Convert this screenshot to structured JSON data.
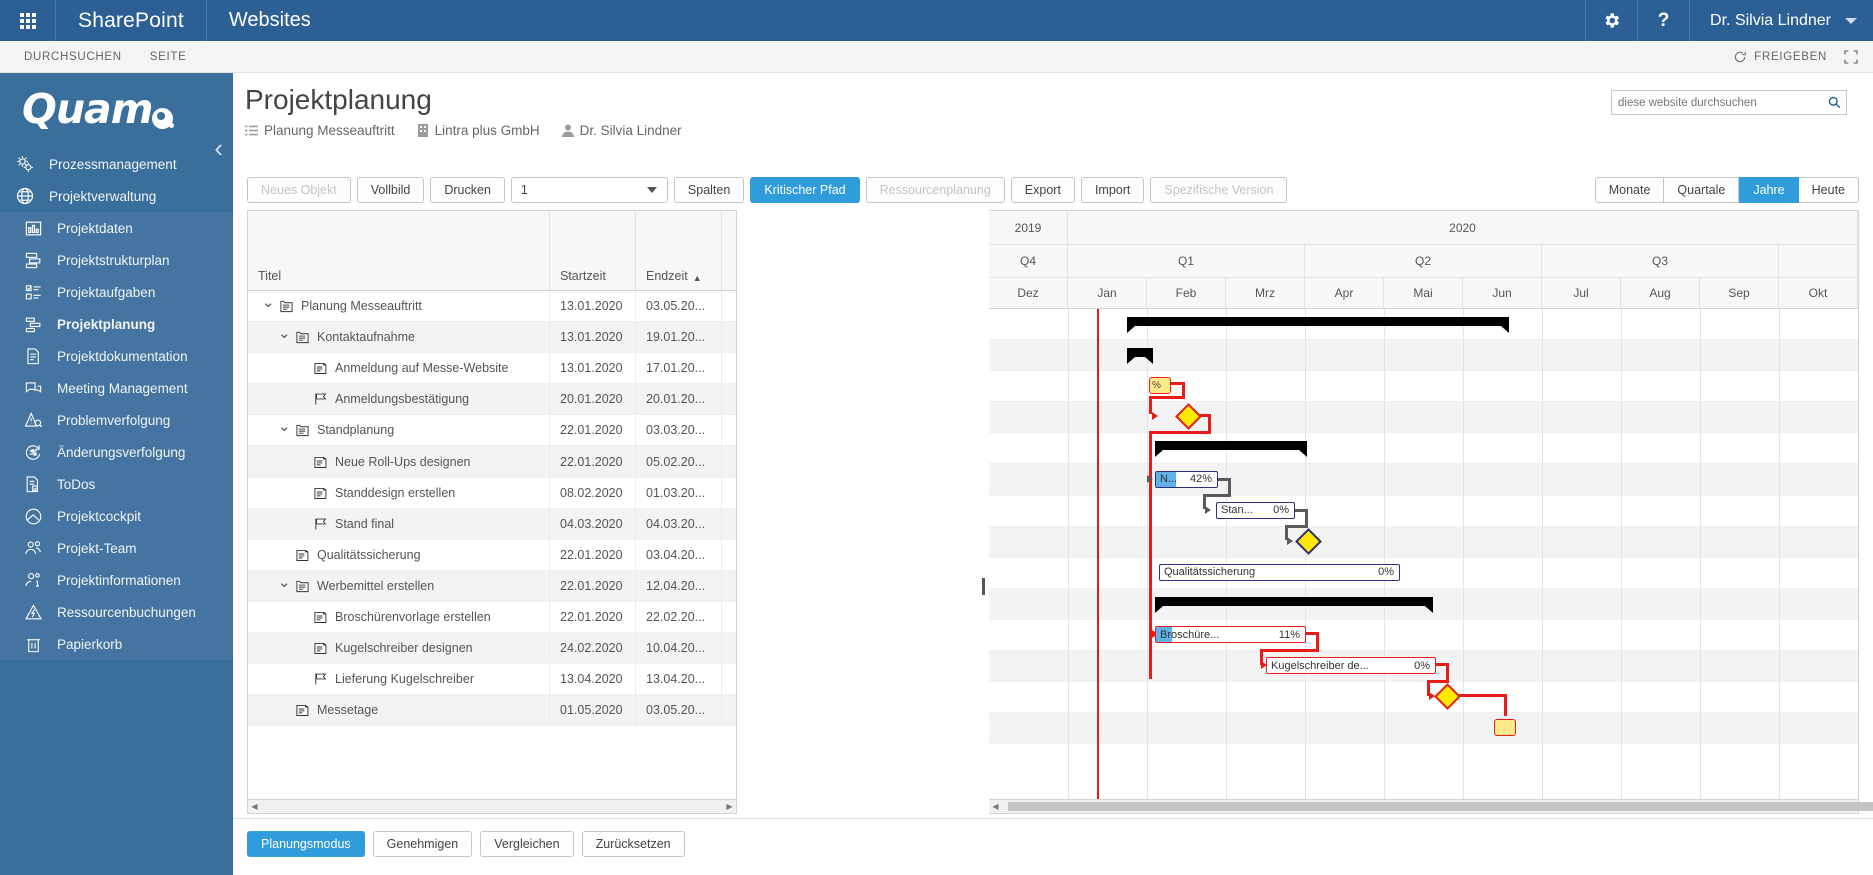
{
  "suitebar": {
    "waffle_icon": "app-launcher-icon",
    "brand": "SharePoint",
    "site": "Websites",
    "settings_icon": "gear-icon",
    "help_icon": "help-icon",
    "user": "Dr. Silvia Lindner"
  },
  "ribbon": {
    "tabs": [
      "DURCHSUCHEN",
      "SEITE"
    ],
    "share_label": "FREIGEBEN",
    "focus_icon": "focus-on-content-icon"
  },
  "leftnav": {
    "logo": "Quam",
    "collapse_icon": "chevron-left-icon",
    "items": [
      {
        "label": "Prozessmanagement",
        "icon": "gears-icon",
        "level": 0,
        "active": false
      },
      {
        "label": "Projektverwaltung",
        "icon": "globe-icon",
        "level": 0,
        "active": false
      },
      {
        "label": "Projektdaten",
        "icon": "bar-chart-icon",
        "level": 1,
        "active": false
      },
      {
        "label": "Projektstrukturplan",
        "icon": "structure-icon",
        "level": 1,
        "active": false
      },
      {
        "label": "Projektaufgaben",
        "icon": "tasklist-icon",
        "level": 1,
        "active": false
      },
      {
        "label": "Projektplanung",
        "icon": "gantt-icon",
        "level": 1,
        "active": true
      },
      {
        "label": "Projektdokumentation",
        "icon": "document-icon",
        "level": 1,
        "active": false
      },
      {
        "label": "Meeting Management",
        "icon": "chat-icon",
        "level": 1,
        "active": false
      },
      {
        "label": "Problemverfolgung",
        "icon": "warning-search-icon",
        "level": 1,
        "active": false
      },
      {
        "label": "Änderungsverfolgung",
        "icon": "change-icon",
        "level": 1,
        "active": false
      },
      {
        "label": "ToDos",
        "icon": "checklist-icon",
        "level": 1,
        "active": false
      },
      {
        "label": "Projektcockpit",
        "icon": "gauge-icon",
        "level": 1,
        "active": false
      },
      {
        "label": "Projekt-Team",
        "icon": "people-icon",
        "level": 1,
        "active": false
      },
      {
        "label": "Projektinformationen",
        "icon": "person-info-icon",
        "level": 1,
        "active": false
      },
      {
        "label": "Ressourcenbuchungen",
        "icon": "resource-icon",
        "level": 1,
        "active": false
      },
      {
        "label": "Papierkorb",
        "icon": "trash-icon",
        "level": 1,
        "active": false
      }
    ]
  },
  "page": {
    "title": "Projektplanung",
    "breadcrumb": [
      {
        "label": "Planung Messeauftritt",
        "icon": "list-icon"
      },
      {
        "label": "Lintra plus GmbH",
        "icon": "building-icon"
      },
      {
        "label": "Dr. Silvia Lindner",
        "icon": "person-icon"
      }
    ]
  },
  "search": {
    "placeholder": "diese website durchsuchen",
    "value": "",
    "icon": "search-icon"
  },
  "toolbar": {
    "buttons": [
      {
        "label": "Neues Objekt",
        "state": "disabled"
      },
      {
        "label": "Vollbild",
        "state": "normal"
      },
      {
        "label": "Drucken",
        "state": "normal"
      }
    ],
    "version_select": {
      "value": "1",
      "icon": "chevron-down-icon"
    },
    "buttons2": [
      {
        "label": "Spalten",
        "state": "normal"
      },
      {
        "label": "Kritischer Pfad",
        "state": "primary"
      },
      {
        "label": "Ressourcenplanung",
        "state": "disabled"
      },
      {
        "label": "Export",
        "state": "normal"
      },
      {
        "label": "Import",
        "state": "normal"
      },
      {
        "label": "Spezifische Version",
        "state": "disabled"
      }
    ],
    "zoom_buttons": [
      {
        "label": "Monate",
        "state": "normal"
      },
      {
        "label": "Quartale",
        "state": "normal"
      },
      {
        "label": "Jahre",
        "state": "primary"
      },
      {
        "label": "Heute",
        "state": "normal"
      }
    ],
    "accent_color": "#2f9ddb"
  },
  "grid": {
    "columns": [
      "Titel",
      "Startzeit",
      "Endzeit"
    ],
    "sort_column": "Endzeit",
    "sort_dir": "asc",
    "sort_icon": "caret-up-icon",
    "rows": [
      {
        "title": "Planung Messeauftritt",
        "start": "13.01.2020",
        "end": "03.05.20...",
        "level": 0,
        "expanded": true,
        "icon": "summary-icon"
      },
      {
        "title": "Kontaktaufnahme",
        "start": "13.01.2020",
        "end": "19.01.20...",
        "level": 1,
        "expanded": true,
        "icon": "summary-icon"
      },
      {
        "title": "Anmeldung auf Messe-Website",
        "start": "13.01.2020",
        "end": "17.01.20...",
        "level": 2,
        "expanded": null,
        "icon": "task-icon"
      },
      {
        "title": "Anmeldungsbestätigung",
        "start": "20.01.2020",
        "end": "20.01.20...",
        "level": 2,
        "expanded": null,
        "icon": "milestone-icon"
      },
      {
        "title": "Standplanung",
        "start": "22.01.2020",
        "end": "03.03.20...",
        "level": 1,
        "expanded": true,
        "icon": "summary-icon"
      },
      {
        "title": "Neue Roll-Ups designen",
        "start": "22.01.2020",
        "end": "05.02.20...",
        "level": 2,
        "expanded": null,
        "icon": "task-icon"
      },
      {
        "title": "Standdesign erstellen",
        "start": "08.02.2020",
        "end": "01.03.20...",
        "level": 2,
        "expanded": null,
        "icon": "task-icon"
      },
      {
        "title": "Stand final",
        "start": "04.03.2020",
        "end": "04.03.20...",
        "level": 2,
        "expanded": null,
        "icon": "milestone-icon"
      },
      {
        "title": "Qualitätssicherung",
        "start": "22.01.2020",
        "end": "03.04.20...",
        "level": 1,
        "expanded": null,
        "icon": "task-icon"
      },
      {
        "title": "Werbemittel erstellen",
        "start": "22.01.2020",
        "end": "12.04.20...",
        "level": 1,
        "expanded": true,
        "icon": "summary-icon"
      },
      {
        "title": "Broschürenvorlage erstellen",
        "start": "22.01.2020",
        "end": "22.02.20...",
        "level": 2,
        "expanded": null,
        "icon": "task-icon"
      },
      {
        "title": "Kugelschreiber designen",
        "start": "24.02.2020",
        "end": "10.04.20...",
        "level": 2,
        "expanded": null,
        "icon": "task-icon"
      },
      {
        "title": "Lieferung Kugelschreiber",
        "start": "13.04.2020",
        "end": "13.04.20...",
        "level": 2,
        "expanded": null,
        "icon": "milestone-icon"
      },
      {
        "title": "Messetage",
        "start": "01.05.2020",
        "end": "03.05.20...",
        "level": 1,
        "expanded": null,
        "icon": "task-icon"
      }
    ]
  },
  "timeline": {
    "years": [
      {
        "label": "2019",
        "months": 1
      },
      {
        "label": "2020",
        "months": 10
      }
    ],
    "quarters": [
      {
        "label": "Q4",
        "months": 1
      },
      {
        "label": "Q1",
        "months": 3
      },
      {
        "label": "Q2",
        "months": 3
      },
      {
        "label": "Q3",
        "months": 3
      },
      {
        "label": "",
        "months": 1
      }
    ],
    "months": [
      "Dez",
      "Jan",
      "Feb",
      "Mrz",
      "Apr",
      "Mai",
      "Jun",
      "Jul",
      "Aug",
      "Sep",
      "Okt"
    ],
    "today_marker": true
  },
  "gantt": {
    "bars": [
      {
        "row": 0,
        "type": "summary",
        "label": "",
        "pct": ""
      },
      {
        "row": 1,
        "type": "summary",
        "label": "",
        "pct": ""
      },
      {
        "row": 2,
        "type": "flag",
        "label": "%",
        "pct": ""
      },
      {
        "row": 3,
        "type": "milestone",
        "label": "",
        "pct": "",
        "critical": true
      },
      {
        "row": 4,
        "type": "summary",
        "label": "",
        "pct": ""
      },
      {
        "row": 5,
        "type": "task",
        "label": "N...",
        "pct": "42%",
        "progress": 42,
        "critical": false
      },
      {
        "row": 6,
        "type": "task",
        "label": "Stan...",
        "pct": "0%",
        "progress": 0,
        "critical": false
      },
      {
        "row": 7,
        "type": "milestone",
        "label": "",
        "pct": "",
        "critical": false
      },
      {
        "row": 8,
        "type": "task",
        "label": "Qualitätssicherung",
        "pct": "0%",
        "progress": 0,
        "critical": false
      },
      {
        "row": 9,
        "type": "summary",
        "label": "",
        "pct": ""
      },
      {
        "row": 10,
        "type": "task",
        "label": "Broschüre...",
        "pct": "11%",
        "progress": 11,
        "critical": true
      },
      {
        "row": 11,
        "type": "task",
        "label": "Kugelschreiber de...",
        "pct": "0%",
        "progress": 0,
        "critical": true
      },
      {
        "row": 12,
        "type": "milestone",
        "label": "",
        "pct": "",
        "critical": true
      },
      {
        "row": 13,
        "type": "flag",
        "label": "",
        "pct": ""
      }
    ],
    "colors": {
      "summary": "#000000",
      "task_border": "#2b2f7d",
      "critical": "#e81b1b",
      "progress": "#5fb2e8",
      "milestone": "#ffe800",
      "today": "#e81b1b"
    }
  },
  "footer": {
    "buttons": [
      {
        "label": "Planungsmodus",
        "state": "primary"
      },
      {
        "label": "Genehmigen",
        "state": "normal"
      },
      {
        "label": "Vergleichen",
        "state": "normal"
      },
      {
        "label": "Zurücksetzen",
        "state": "normal"
      }
    ]
  }
}
